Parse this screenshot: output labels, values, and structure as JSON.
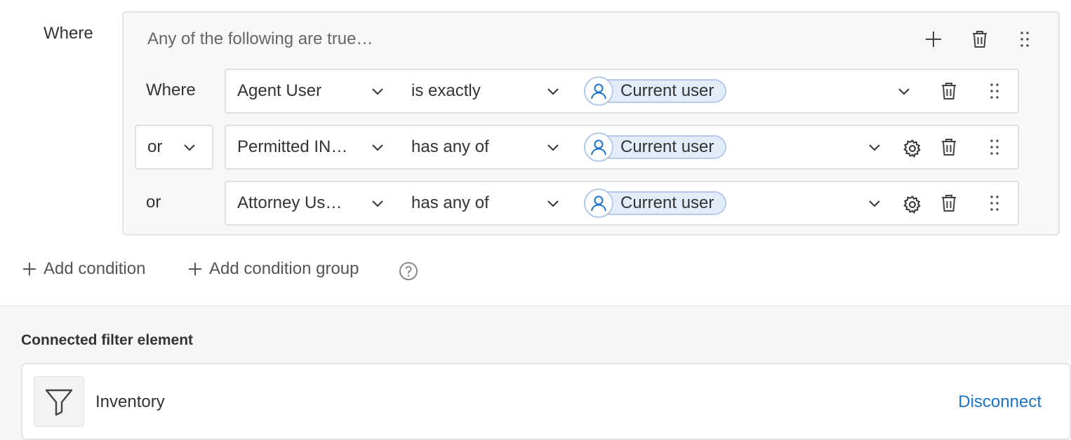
{
  "filter": {
    "where_label": "Where",
    "group": {
      "title": "Any of the following are true…",
      "conditions": [
        {
          "conjunction": "Where",
          "field": "Agent User",
          "operator": "is exactly",
          "value": "Current user",
          "has_settings": false
        },
        {
          "conjunction": "or",
          "field": "Permitted IN…",
          "operator": "has any of",
          "value": "Current user",
          "has_settings": true
        },
        {
          "conjunction": "or",
          "field": "Attorney Us…",
          "operator": "has any of",
          "value": "Current user",
          "has_settings": true
        }
      ]
    },
    "add_condition_label": "Add condition",
    "add_condition_group_label": "Add condition group"
  },
  "connected": {
    "section_title": "Connected filter element",
    "element_name": "Inventory",
    "disconnect_label": "Disconnect"
  },
  "colors": {
    "accent": "#1a73c8",
    "chip_bg": "#e3edf9",
    "chip_border": "#b3cbe8"
  },
  "icons": {
    "group_add": "plus-icon",
    "group_delete": "trash-icon",
    "group_drag": "drag-handle-icon",
    "row_delete": "trash-icon",
    "row_drag": "drag-handle-icon",
    "settings": "gear-icon",
    "dropdown": "chevron-down-icon",
    "avatar": "user-icon",
    "help": "help-icon",
    "element": "funnel-icon"
  }
}
